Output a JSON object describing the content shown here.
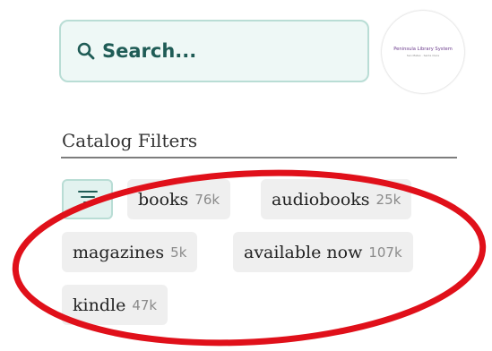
{
  "search": {
    "placeholder": "Search..."
  },
  "logo": {
    "title": "Peninsula Library System",
    "subtitle": "San Mateo · Santa Clara"
  },
  "filters": {
    "section_title": "Catalog Filters",
    "chips": [
      {
        "label": "books",
        "count": "76k"
      },
      {
        "label": "audiobooks",
        "count": "25k"
      },
      {
        "label": "magazines",
        "count": "5k"
      },
      {
        "label": "available now",
        "count": "107k"
      },
      {
        "label": "kindle",
        "count": "47k"
      }
    ]
  },
  "colors": {
    "accent": "#1f5c56",
    "search_bg": "#eef8f6",
    "chip_bg": "#efefef",
    "annotation": "#e0101a"
  },
  "icons": {
    "search": "search-icon",
    "filter": "filter-lines-icon"
  }
}
